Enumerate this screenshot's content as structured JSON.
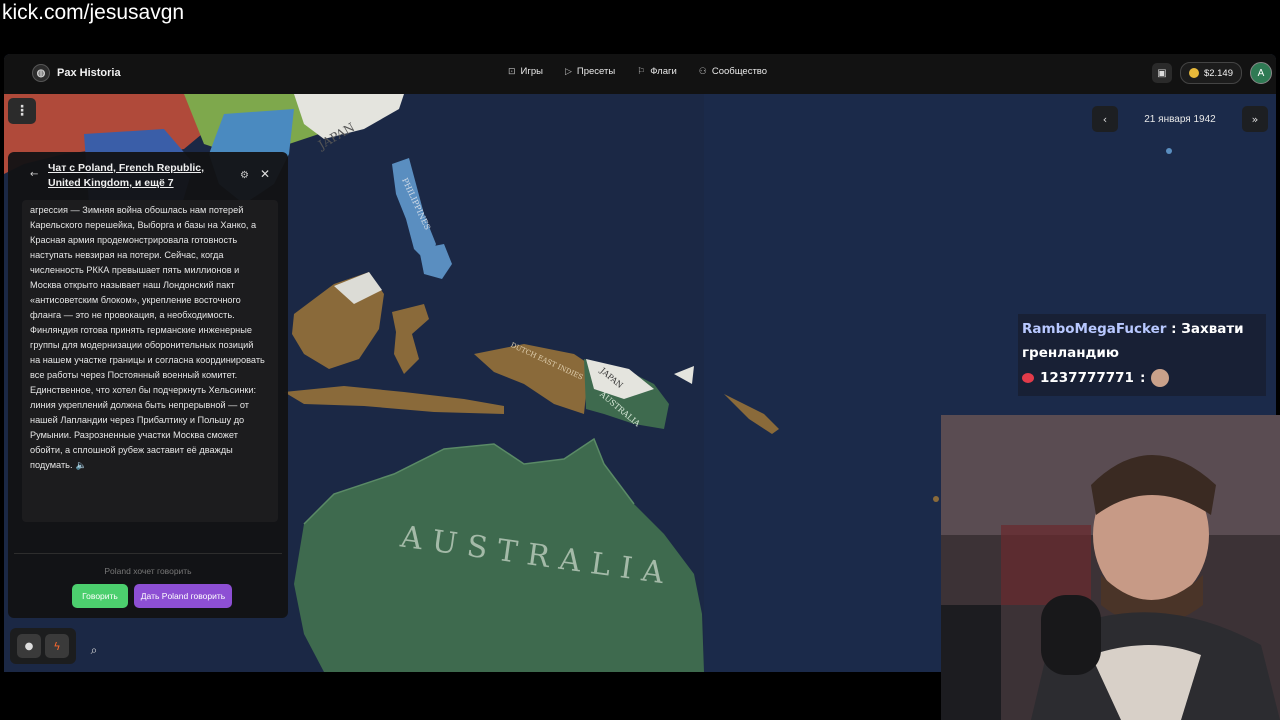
{
  "watermark": "kick.com/jesusavgn",
  "app": {
    "brand": "Pax Historia",
    "nav": [
      {
        "label": "Игры",
        "icon": "gamepad-icon"
      },
      {
        "label": "Пресеты",
        "icon": "play-icon"
      },
      {
        "label": "Флаги",
        "icon": "flag-icon"
      },
      {
        "label": "Сообщество",
        "icon": "community-icon"
      }
    ],
    "coins": "$2.149",
    "avatar_letter": "A",
    "date": "21 января 1942"
  },
  "chat": {
    "title": "Чат с Poland, French Republic, United Kingdom, и ещё 7",
    "message": "агрессия — Зимняя война обошлась нам потерей Карельского перешейка, Выборга и базы на Ханко, а Красная армия продемонстрировала готовность наступать невзирая на потери. Сейчас, когда численность РККА превышает пять миллионов и Москва открыто называет наш Лондонский пакт «антисоветским блоком», укрепление восточного фланга — это не провокация, а необходимость. Финляндия готова принять германские инженерные группы для модернизации оборонительных позиций на нашем участке границы и согласна координировать все работы через Постоянный военный комитет. Единственное, что хотел бы подчеркнуть Хельсинки: линия укреплений должна быть непрерывной — от нашей Лапландии через Прибалтику и Польшу до Румынии. Разрозненные участки Москва сможет обойти, а сплошной рубеж заставит её дважды подумать.",
    "wants_to_speak": "Poland хочет говорить",
    "speak_button": "Говорить",
    "let_speak_button": "Дать Poland говорить"
  },
  "map_labels": {
    "australia": "AUSTRALIA",
    "japan": "JAPAN",
    "dutch_east_indies": "DUTCH EAST INDIES",
    "philippines": "PHILIPPINES",
    "australia_png": "AUSTRALIA",
    "japan_png": "JAPAN"
  },
  "stream_chat": {
    "user": "RamboMegaFucker",
    "separator": " : ",
    "message": "Захвати гренландию",
    "user2": "1237777771",
    "separator2": " :"
  },
  "colors": {
    "ocean": "#1a2740",
    "australia": "#3e6a4e",
    "dutch": "#8a6a3a",
    "japan": "#e8e8e4",
    "speak_button": "#4ccf6e",
    "let_speak_button": "#8d4fd4"
  }
}
